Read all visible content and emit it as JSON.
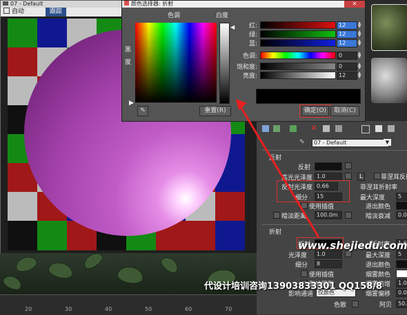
{
  "viewport": {
    "title": "07 - Default",
    "toolbar": {
      "auto": "自动",
      "track": "跟踪"
    }
  },
  "dialog": {
    "title": "颜色选择器: 折射",
    "hue_header": "色调",
    "white_header": "白度",
    "black_label": "黑",
    "degree_label": "度",
    "rows": [
      {
        "label": "红:",
        "value": "12",
        "color": "#e01010"
      },
      {
        "label": "绿:",
        "value": "12",
        "color": "#10c010"
      },
      {
        "label": "蓝:",
        "value": "12",
        "color": "#1020e0"
      },
      {
        "label": "色调:",
        "value": "0",
        "color": "rainbow"
      },
      {
        "label": "饱和度:",
        "value": "0",
        "color": "#888888"
      },
      {
        "label": "亮度:",
        "value": "12",
        "color": "#ffffff"
      }
    ],
    "reset": "重置(R)",
    "ok": "确定(O)",
    "cancel": "取消(C)"
  },
  "panel": {
    "material_name": "07 - Default",
    "reflection": {
      "section": "反射",
      "reflect": "反射",
      "hilight_gloss": "高光光泽度",
      "hilight_value": "1.0",
      "L": "L",
      "fresnel": "菲涅耳反射",
      "fresnel_ior": "菲涅耳折射率",
      "refl_gloss": "反射光泽度",
      "refl_gloss_value": "0.66",
      "subdivs": "细分",
      "subdivs_value": "15",
      "max_depth": "最大深度",
      "max_depth_value": "5",
      "use_interp": "使用插值",
      "exit_color": "退出颜色",
      "dim_distance": "暗淡距离",
      "dim_value": "100.0m",
      "dim_falloff": "暗淡衰减",
      "dim_falloff_value": "0.0"
    },
    "refraction": {
      "section": "折射",
      "refract": "折射",
      "ior": "折射率",
      "ior_value": "1.6",
      "gloss": "光泽度",
      "gloss_value": "1.0",
      "max_depth": "最大深度",
      "max_depth_value": "5",
      "subdivs": "细分",
      "subdivs_value": "8",
      "exit_color": "退出颜色",
      "use_interp": "使用插值",
      "fog_color": "烟雾颜色",
      "affect_shadows": "影响阴影",
      "fog_mult": "烟雾倍增",
      "fog_mult_value": "1.0",
      "affect_channels": "影响通道",
      "channel_option": "仅颜色",
      "fog_bias": "烟雾偏移",
      "fog_bias_value": "0.0",
      "dispersion": "色散",
      "abbe": "阿贝",
      "abbe_value": "50.0"
    }
  },
  "watermark": {
    "site": "www.shejiedu.com",
    "text": "代设计培训咨询13903833301 QQ158/8"
  },
  "timeline": {
    "ticks": [
      "20",
      "30",
      "40",
      "50",
      "60",
      "70"
    ]
  }
}
